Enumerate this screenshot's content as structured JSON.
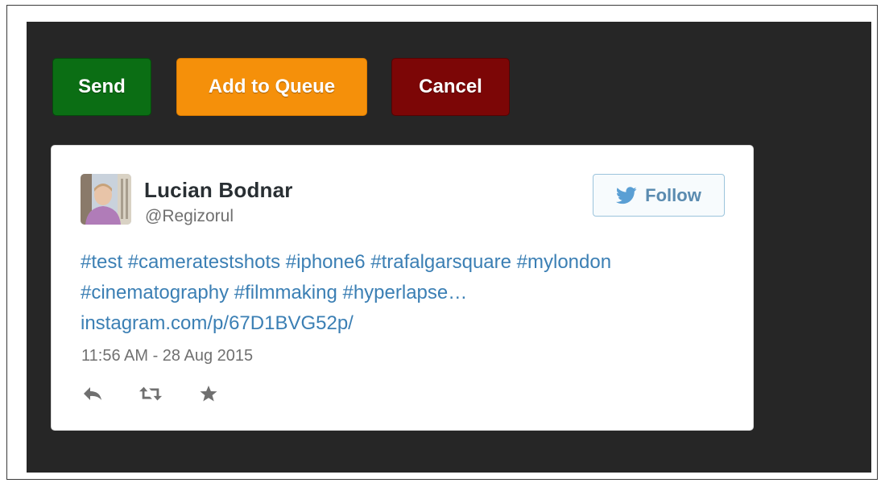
{
  "toolbar": {
    "send_label": "Send",
    "queue_label": "Add to Queue",
    "cancel_label": "Cancel"
  },
  "tweet": {
    "author_name": "Lucian Bodnar",
    "author_handle": "@Regizorul",
    "follow_label": "Follow",
    "text_lines": [
      "#test #cameratestshots #iphone6 #trafalgarsquare #mylondon",
      "#cinematography #filmmaking #hyperlapse…",
      "instagram.com/p/67D1BVG52p/"
    ],
    "timestamp": "11:56 AM - 28 Aug 2015",
    "actions": [
      "reply-icon",
      "retweet-icon",
      "favorite-icon"
    ]
  },
  "colors": {
    "send": "#0b6e14",
    "queue": "#f5900a",
    "cancel": "#7c0606",
    "panel": "#262626",
    "link": "#3b7fb4",
    "twitter_blue": "#5a9fd4"
  }
}
